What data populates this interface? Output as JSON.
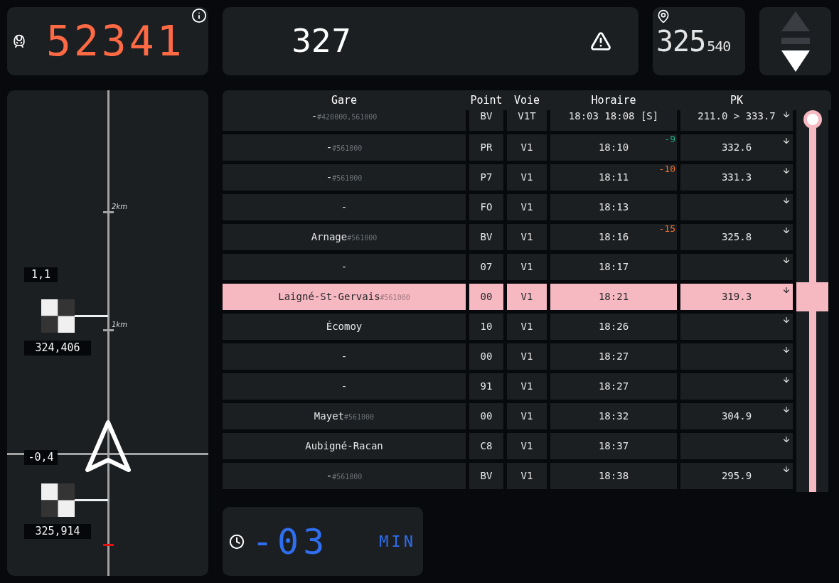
{
  "train_panel": {
    "train_number": "52341"
  },
  "message_panel": {
    "text": "327"
  },
  "position_panel": {
    "km": "325",
    "meters": "540"
  },
  "direction_controls": [
    {
      "kind": "up",
      "selected": false
    },
    {
      "kind": "hold",
      "selected": false
    },
    {
      "kind": "down",
      "selected": true
    }
  ],
  "track_view": {
    "scale_labels": [
      "2km",
      "1km"
    ],
    "markers": [
      {
        "distance": "1,1",
        "pk": "324,406"
      },
      {
        "distance": "-0,4",
        "pk": "325,914"
      }
    ]
  },
  "schedule": {
    "columns": [
      "Gare",
      "Point",
      "Voie",
      "Horaire",
      "PK"
    ],
    "rows": [
      {
        "gare": "-$_{#420000,561000}$",
        "point": "BV",
        "voie": "V1T",
        "horaire": "18:03 18:08 [S]",
        "pk": "211.0 > 333.7",
        "selected": false
      },
      {
        "gare": "-$_{#561000}$",
        "point": "PR",
        "voie": "V1",
        "horaire": "18:10",
        "delay": {
          "text": "-9",
          "color": "#1fae7e"
        },
        "pk": "332.6",
        "selected": false
      },
      {
        "gare": "-$_{#561000}$",
        "point": "P7",
        "voie": "V1",
        "horaire": "18:11",
        "delay": {
          "text": "-10",
          "color": "#f0702a"
        },
        "pk": "331.3",
        "selected": false
      },
      {
        "gare": "-",
        "point": "FO",
        "voie": "V1",
        "horaire": "18:13",
        "selected": false
      },
      {
        "gare": "Arnage$_{#561000}$",
        "point": "BV",
        "voie": "V1",
        "horaire": "18:16",
        "delay": {
          "text": "-15",
          "color": "#f0702a"
        },
        "pk": "325.8",
        "selected": false
      },
      {
        "gare": "-",
        "point": "07",
        "voie": "V1",
        "horaire": "18:17",
        "selected": false
      },
      {
        "gare": "Laigné-St-Gervais$_{#561000}$",
        "point": "00",
        "voie": "V1",
        "horaire": "18:21",
        "pk": "319.3",
        "selected": true
      },
      {
        "gare": "Écomoy",
        "point": "10",
        "voie": "V1",
        "horaire": "18:26",
        "selected": false
      },
      {
        "gare": "-",
        "point": "00",
        "voie": "V1",
        "horaire": "18:27",
        "selected": false
      },
      {
        "gare": "-",
        "point": "91",
        "voie": "V1",
        "horaire": "18:27",
        "selected": false
      },
      {
        "gare": "Mayet$_{#561000}$",
        "point": "00",
        "voie": "V1",
        "horaire": "18:32",
        "pk": "304.9",
        "selected": false
      },
      {
        "gare": "Aubigné-Racan",
        "point": "C8",
        "voie": "V1",
        "horaire": "18:37",
        "selected": false
      },
      {
        "gare": "-$_{#561000}$",
        "point": "BV",
        "voie": "V1",
        "horaire": "18:38",
        "pk": "295.9",
        "selected": false
      }
    ],
    "scrollbar": {
      "level": 0
    }
  },
  "countdown": {
    "value": "-03",
    "unit": "MIN"
  }
}
